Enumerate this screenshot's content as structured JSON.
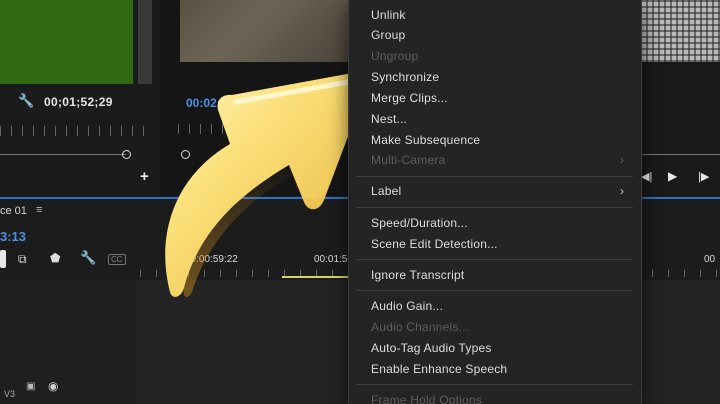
{
  "source_monitor": {
    "timecode": "00;01;52;29",
    "add_label": "+"
  },
  "program_monitor": {
    "timecode": "00:02:2"
  },
  "transport": {
    "step_back": "◀|",
    "play": "▶",
    "step_forward": "|▶"
  },
  "timeline": {
    "sequence_tab": "ce 01",
    "tab_menu": "≡",
    "timecode": "3:13",
    "cc_label": "CC",
    "ruler_labels": [
      "00:00:59:22",
      "00:01:5",
      "00"
    ],
    "track_v3": "V3"
  },
  "context_menu": {
    "items": [
      {
        "label": "Unlink",
        "enabled": true
      },
      {
        "label": "Group",
        "enabled": true
      },
      {
        "label": "Ungroup",
        "enabled": false
      },
      {
        "label": "Synchronize",
        "enabled": true
      },
      {
        "label": "Merge Clips...",
        "enabled": true
      },
      {
        "label": "Nest...",
        "enabled": true
      },
      {
        "label": "Make Subsequence",
        "enabled": true
      },
      {
        "label": "Multi-Camera",
        "enabled": false,
        "submenu": true
      },
      {
        "label": "Label",
        "enabled": true,
        "submenu": true
      },
      {
        "label": "Speed/Duration...",
        "enabled": true
      },
      {
        "label": "Scene Edit Detection...",
        "enabled": true
      },
      {
        "label": "Ignore Transcript",
        "enabled": true
      },
      {
        "label": "Audio Gain...",
        "enabled": true
      },
      {
        "label": "Audio Channels...",
        "enabled": false
      },
      {
        "label": "Auto-Tag Audio Types",
        "enabled": true
      },
      {
        "label": "Enable Enhance Speech",
        "enabled": true
      },
      {
        "label": "Frame Hold Options",
        "enabled": false
      }
    ],
    "submenu_chevron": "›"
  },
  "colors": {
    "timecode_blue": "#4a90e2",
    "menu_background": "#242424",
    "arrow_yellow": "#f7d35a"
  },
  "icons": [
    "wrench-icon",
    "snap-icon",
    "marker-icon",
    "film-icon",
    "eye-icon",
    "chevron-right-icon",
    "arrow-sticker"
  ]
}
